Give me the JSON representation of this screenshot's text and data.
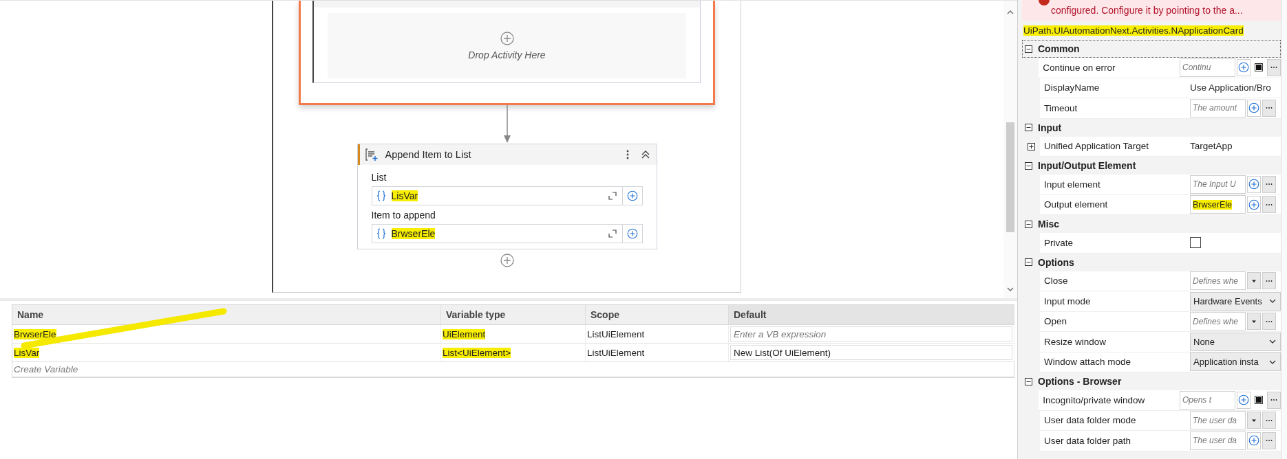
{
  "designer": {
    "scope_card": {
      "drop_hint": "Drop Activity Here"
    },
    "activity": {
      "title": "Append Item to List",
      "fields": [
        {
          "label": "List",
          "value": "LisVar",
          "highlighted": true
        },
        {
          "label": "Item to append",
          "value": "BrwserEle",
          "highlighted": true
        }
      ]
    }
  },
  "variables": {
    "columns": [
      "Name",
      "Variable type",
      "Scope",
      "Default"
    ],
    "rows": [
      {
        "name": "BrwserEle",
        "type": "UiElement",
        "scope": "ListUiElement",
        "default_placeholder": "Enter a VB expression",
        "highlighted": true
      },
      {
        "name": "LisVar",
        "type": "List<UiElement>",
        "scope": "ListUiElement",
        "default": "New List(Of UiElement)",
        "highlighted": true
      }
    ],
    "create_hint": "Create Variable"
  },
  "properties": {
    "error": "configured. Configure it by pointing to the a...",
    "type_name": "UiPath.UIAutomationNext.Activities.NApplicationCard",
    "type_highlighted": true,
    "categories": [
      {
        "name": "Common",
        "expanded": true,
        "items": [
          {
            "name": "Continue on error",
            "kind": "expr-toggle",
            "placeholder": "Continu"
          },
          {
            "name": "DisplayName",
            "kind": "text",
            "value": "Use Application/Bro"
          },
          {
            "name": "Timeout",
            "kind": "expr",
            "placeholder": "The amount"
          }
        ]
      },
      {
        "name": "Input",
        "expanded": true,
        "items": [
          {
            "name": "Unified Application Target",
            "kind": "nested",
            "expanded": false,
            "value": "TargetApp"
          }
        ]
      },
      {
        "name": "Input/Output Element",
        "expanded": true,
        "items": [
          {
            "name": "Input element",
            "kind": "expr",
            "placeholder": "The Input U"
          },
          {
            "name": "Output element",
            "kind": "expr",
            "value": "BrwserEle",
            "highlighted": true
          }
        ]
      },
      {
        "name": "Misc",
        "expanded": true,
        "items": [
          {
            "name": "Private",
            "kind": "checkbox",
            "checked": false
          }
        ]
      },
      {
        "name": "Options",
        "expanded": true,
        "items": [
          {
            "name": "Close",
            "kind": "enum-expr",
            "placeholder": "Defines whe"
          },
          {
            "name": "Input mode",
            "kind": "select",
            "value": "Hardware Events"
          },
          {
            "name": "Open",
            "kind": "enum-expr",
            "placeholder": "Defines whe"
          },
          {
            "name": "Resize window",
            "kind": "select",
            "value": "None"
          },
          {
            "name": "Window attach mode",
            "kind": "select",
            "value": "Application insta"
          }
        ]
      },
      {
        "name": "Options - Browser",
        "expanded": true,
        "items": [
          {
            "name": "Incognito/private window",
            "kind": "expr-toggle",
            "placeholder": "Opens t"
          },
          {
            "name": "User data folder mode",
            "kind": "enum-expr",
            "placeholder": "The user da"
          },
          {
            "name": "User data folder path",
            "kind": "expr",
            "placeholder": "The user da"
          }
        ]
      }
    ]
  }
}
